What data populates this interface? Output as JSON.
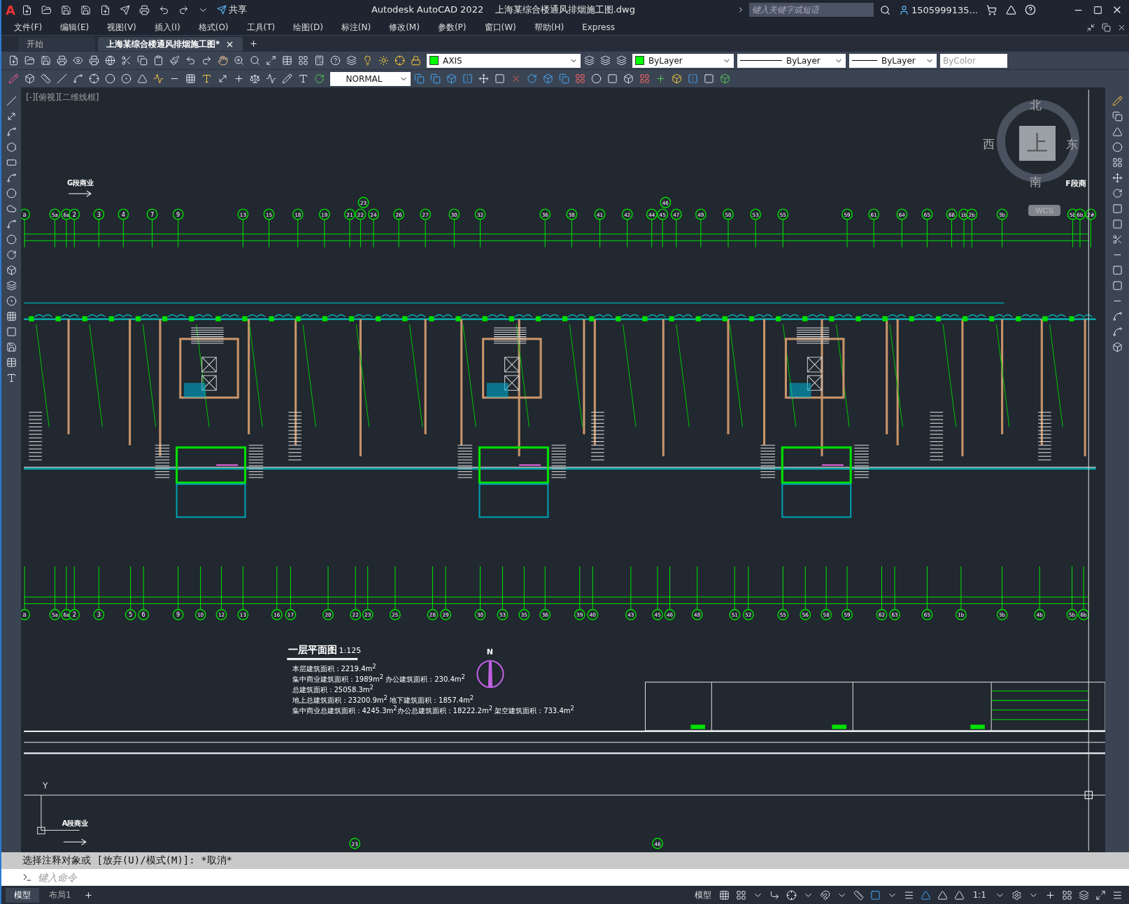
{
  "window": {
    "app_title": "Autodesk AutoCAD 2022",
    "file_title": "上海某综合楼通风排烟施工图.dwg"
  },
  "quick_access": {
    "share_label": "共享"
  },
  "search": {
    "placeholder": "键入关键字或短语"
  },
  "user": {
    "name": "1505999135..."
  },
  "menu": [
    "文件(F)",
    "编辑(E)",
    "视图(V)",
    "插入(I)",
    "格式(O)",
    "工具(T)",
    "绘图(D)",
    "标注(N)",
    "修改(M)",
    "参数(P)",
    "窗口(W)",
    "帮助(H)",
    "Express"
  ],
  "doc_tabs": [
    {
      "label": "开始",
      "selected": false
    },
    {
      "label": "上海某综合楼通风排烟施工图*",
      "selected": true
    }
  ],
  "app_logo": "A",
  "properties": {
    "layer": "AXIS",
    "color_control": "ByLayer",
    "linetype": "ByLayer",
    "lineweight": "ByLayer",
    "plot_style": "ByColor"
  },
  "text_style": "NORMAL",
  "viewport_label": "[-][俯视][二维线框]",
  "viewcube": {
    "north": "北",
    "south": "南",
    "east": "东",
    "west": "西",
    "face": "上",
    "ucs": "WCS"
  },
  "drawing": {
    "top_axes": [
      "a",
      "5a",
      "6a",
      "2",
      "3",
      "4",
      "7",
      "9",
      "13",
      "15",
      "18",
      "19",
      "21",
      "22",
      "24",
      "26",
      "27",
      "30",
      "32",
      "36",
      "38",
      "41",
      "42",
      "44",
      "45",
      "47",
      "49",
      "50",
      "53",
      "55",
      "59",
      "61",
      "64",
      "65",
      "66",
      "1b",
      "2b",
      "3b",
      "5b",
      "6b",
      "2#"
    ],
    "top_extra_axes": [
      "23",
      "46"
    ],
    "bottom_axes": [
      "a",
      "5a",
      "6a",
      "2",
      "3",
      "5",
      "6",
      "9",
      "10",
      "12",
      "13",
      "16",
      "17",
      "20",
      "22",
      "23",
      "25",
      "28",
      "29",
      "30",
      "33",
      "35",
      "36",
      "39",
      "40",
      "43",
      "45",
      "46",
      "48",
      "51",
      "52",
      "55",
      "56",
      "58",
      "59",
      "62",
      "63",
      "65",
      "1b",
      "3b",
      "4b",
      "5b",
      "6b"
    ],
    "lower_extra_axes": [
      "23",
      "46"
    ],
    "zone_labels": [
      "G段商业",
      "F段商",
      "A段商业"
    ],
    "plan_title": "一层平面图",
    "plan_scale": "1:125",
    "area_notes": [
      "本层建筑面积：2219.4m$^{2}$",
      "集中商业建筑面积：1989m$^{2}$ 办公建筑面积：230.4m$^{2}$",
      "总建筑面积：25058.3m$^{2}$",
      "地上总建筑面积：23200.9m$^{2}$ 地下建筑面积：1857.4m$^{2}$",
      "集中商业总建筑面积：4245.3m$^{2}$办公总建筑面积：18222.2m$^{2}$ 架空建筑面积：733.4m$^{2}$"
    ],
    "north_label": "N",
    "ucs_y": "Y"
  },
  "command": {
    "history": "选择注释对象或 [放弃(U)/模式(M)]: *取消*",
    "placeholder": "键入命令"
  },
  "layout_tabs": [
    {
      "label": "模型",
      "selected": true
    },
    {
      "label": "布局1",
      "selected": false
    }
  ],
  "status": {
    "space": "模型",
    "scale": "1:1"
  }
}
